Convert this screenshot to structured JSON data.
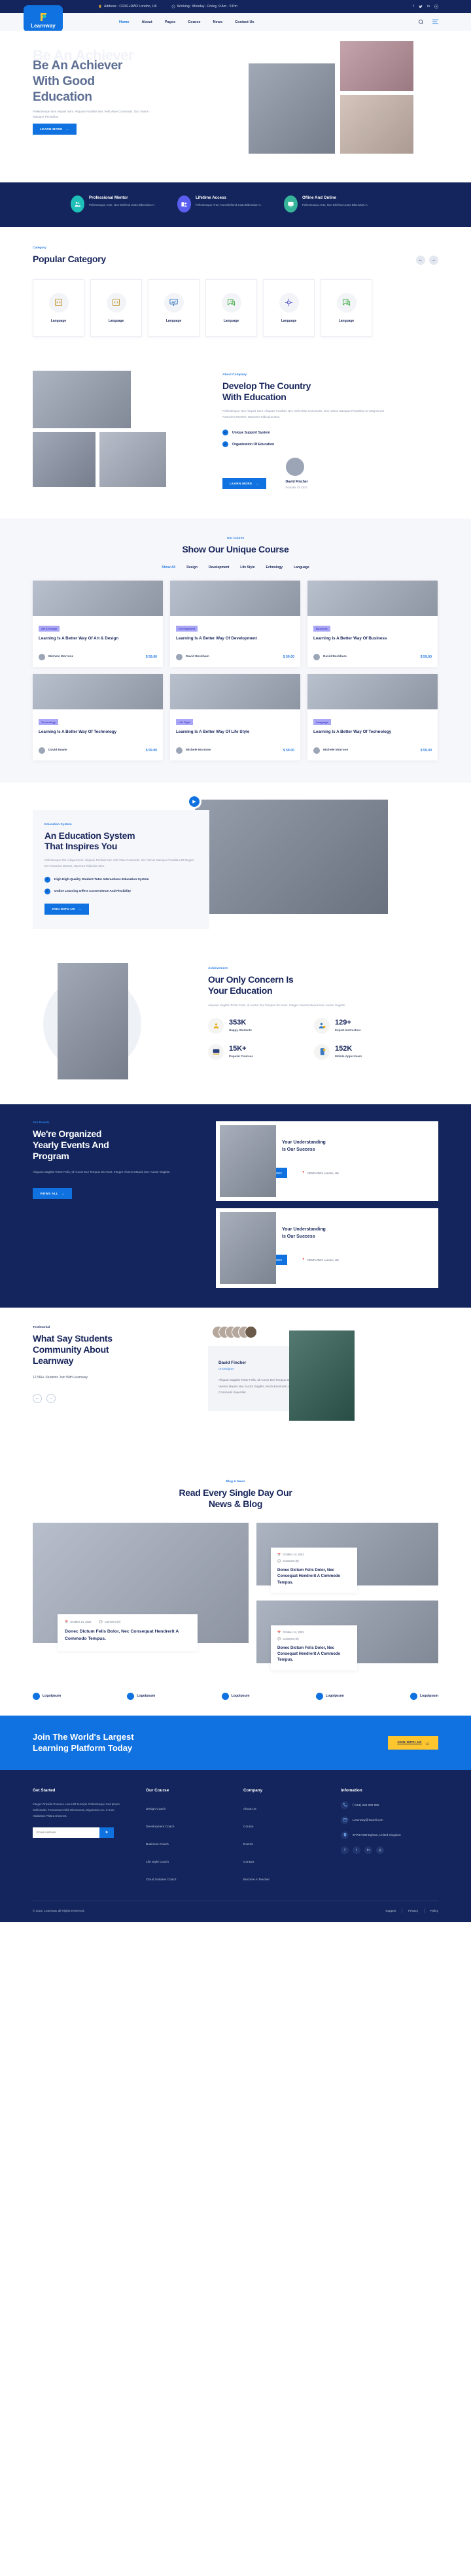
{
  "topbar": {
    "address": "Address : CRXF+RW3 London, UK",
    "working": "Working : Monday - Friday, 9:Am - 5:Pm",
    "social": [
      "facebook-icon",
      "twitter-icon",
      "linkedin-icon",
      "instagram-icon"
    ]
  },
  "nav": {
    "brand": "Learnway",
    "links": [
      {
        "label": "Home",
        "active": true
      },
      {
        "label": "About",
        "active": false
      },
      {
        "label": "Pages",
        "active": false,
        "caret": true
      },
      {
        "label": "Course",
        "active": false,
        "caret": true
      },
      {
        "label": "News",
        "active": false
      },
      {
        "label": "Contact Us",
        "active": false
      }
    ]
  },
  "hero": {
    "ghost": "Be An Achiever",
    "title_line1": "Be An Achiever",
    "title_line2": "With Good",
    "title_line3": "Education",
    "paragraph": "Pellentesque Non Aliquet Sem. Aliquam Facilisis Nec Velit Vitae Commodo. Orci Varius Natoque Penatibus",
    "cta": "LEARN MORE"
  },
  "features": [
    {
      "title": "Professional Mentor",
      "text": "Pellentesque Ante, Non Eleifend Justo Bibendum A.",
      "color": "#1fc0b8",
      "icon": "mentor-icon"
    },
    {
      "title": "Lifetime Access",
      "text": "Pellentesque Ante, Non Eleifend Justo Bibendum A.",
      "color": "#5a5ef0",
      "icon": "access-icon"
    },
    {
      "title": "Ofline And Online",
      "text": "Pellentesque Ante, Non Eleifend Justo Bibendum A.",
      "color": "#35b49a",
      "icon": "online-icon"
    }
  ],
  "category": {
    "eyebrow": "Category",
    "title": "Popular Category",
    "prev": "arrow-left-icon",
    "next": "arrow-right-icon",
    "items": [
      {
        "label": "Language",
        "icon": "code-icon"
      },
      {
        "label": "Language",
        "icon": "code-icon"
      },
      {
        "label": "Language",
        "icon": "chart-board-icon"
      },
      {
        "label": "Language",
        "icon": "chat-bubble-icon"
      },
      {
        "label": "Language",
        "icon": "network-icon"
      },
      {
        "label": "Language",
        "icon": "chat-bubble-icon"
      }
    ]
  },
  "about": {
    "eyebrow": "About Company",
    "title_line1": "Develop The Country",
    "title_line2": "With Education",
    "paragraph": "Pellentesque Non Aliquet Sem. Aliquam Facilisis Nec Velit Vitae Commodo. Orci Varius Natoque Penatibus Et Magnis Dis Parturient Montes, Nascetur Ridiculus Mus.",
    "checks": [
      "Unique Support System",
      "Organization Of Education"
    ],
    "cta": "LEARN MORE",
    "person_name": "David Fincher",
    "person_role": "Founder Of CEO"
  },
  "courses": {
    "eyebrow": "Our Course",
    "title": "Show Our Unique Course",
    "tabs": [
      {
        "label": "Show All",
        "active": true
      },
      {
        "label": "Design",
        "active": false
      },
      {
        "label": "Development",
        "active": false
      },
      {
        "label": "Life Style",
        "active": false
      },
      {
        "label": "Echnology",
        "active": false
      },
      {
        "label": "Language",
        "active": false
      }
    ],
    "items": [
      {
        "tag": "Art & Design",
        "title": "Learning Is A Better Way Of Art & Design",
        "author": "Michele Morrone",
        "price": "$ 59.00"
      },
      {
        "tag": "Development",
        "title": "Learning Is A Better Way Of Development",
        "author": "David Beckham",
        "price": "$ 59.00"
      },
      {
        "tag": "Business",
        "title": "Learning Is A Better Way Of Business",
        "author": "David Beckham",
        "price": "$ 59.00"
      },
      {
        "tag": "Technology",
        "title": "Learning Is A Better Way Of Technology",
        "author": "David Bowie",
        "price": "$ 59.00"
      },
      {
        "tag": "Life Style",
        "title": "Learning Is A Better Way Of Life Style",
        "author": "Michele Morrone",
        "price": "$ 59.00"
      },
      {
        "tag": "Language",
        "title": "Learning Is A Better Way Of Technology",
        "author": "Michele Morrone",
        "price": "$ 59.00"
      }
    ]
  },
  "edu": {
    "eyebrow": "Education System",
    "title_line1": "An Education System",
    "title_line2": "That Inspires You",
    "paragraph": "Pellentesque Non Aliquet Sem. Aliquam Facilisis Nec Velit Vitae Commodo. Orci Varius Natoque Penatibus Et Magnis Dis Parturient Montes, Nascetur Ridiculus Mus.",
    "checks": [
      "High High-Quality Student-Tutor Interactions Education System",
      "Online Learning Offers Convenience And Flexibility"
    ],
    "cta": "JOIN WITH US",
    "play": "play-icon"
  },
  "achievement": {
    "eyebrow": "Achievement",
    "title_line1": "Our Only Concern Is",
    "title_line2": "Your Education",
    "paragraph": "Aliquam Sagittis Tortor Felis, Id Auctor Dui Tempus Sit Amet. Integer Viverra Mauris Nec Auctor Sagittis.",
    "stats": [
      {
        "num": "353K",
        "label": "Happy Students",
        "icon": "students-icon"
      },
      {
        "num": "129+",
        "label": "Expert Instructors",
        "icon": "instructor-icon"
      },
      {
        "num": "15K+",
        "label": "Popular Courses",
        "icon": "courses-icon"
      },
      {
        "num": "152K",
        "label": "Mobile Apps Users",
        "icon": "mobile-icon"
      }
    ]
  },
  "events": {
    "eyebrow": "Our Events",
    "title_line1": "We're Organized",
    "title_line2": "Yearly Events And",
    "title_line3": "Program",
    "paragraph": "Aliquam Sagittis Tortor Felis, Id Auctor Dui Tempus Sit Amet. Integer Viverra Mauris Nec Auctor Sagittis.",
    "cta": "VIEWS ALL",
    "cards": [
      {
        "title_line1": "Your Understanding",
        "title_line2": "Is Our Success",
        "date": "31 March, 2022",
        "location": "CRXF+RW3 London, UK"
      },
      {
        "title_line1": "Your Understanding",
        "title_line2": "Is Our Success",
        "date": "31 March, 2022",
        "location": "CRXF+RW3 London, UK"
      }
    ]
  },
  "testimonial": {
    "eyebrow": "Testimonial",
    "title_line1": "What Say Students",
    "title_line2": "Community About",
    "title_line3": "Learnway",
    "note": "12.56k+ Students Join With Learnway",
    "prev": "arrow-left-icon",
    "next": "arrow-right-icon",
    "name": "David Fincher",
    "role": "UI-Designer",
    "quote": "Aliquam Sagittis Tortor Felis, Id Auctor Dui Tempus Sit Amet. Integer Viverra Mauris Nec Auctor Sagittis. Morbi Euismod Lacus Et Enim Commodo Imperdiet."
  },
  "blog": {
    "eyebrow": "Blog & News",
    "title_line1": "Read Every Single Day Our",
    "title_line2": "News & Blog",
    "main": {
      "date": "October 14, 2022",
      "comments": "Comment (0)",
      "title": "Donec Dictum Felis Dolor, Nec Consequat Hendrerit A Commodo Tempus."
    },
    "side": [
      {
        "date": "October 14, 2022",
        "comments": "Comment (0)",
        "title": "Donec Dictum Felis Dolor, Nec Consequat Hendrerit A Commodo Tempus."
      },
      {
        "date": "October 14, 2022",
        "comments": "Comment (0)",
        "title": "Donec Dictum Felis Dolor, Nec Consequat Hendrerit A Commodo Tempus."
      }
    ]
  },
  "brands": [
    {
      "label": "Logoipsum"
    },
    {
      "label": "Logoipsum"
    },
    {
      "label": "Logoipsum"
    },
    {
      "label": "Logoipsum"
    },
    {
      "label": "Logoipsum"
    }
  ],
  "cta": {
    "title_line1": "Join The World's Largest",
    "title_line2": "Learning Platform Today",
    "button": "JOIN WITH US"
  },
  "footer": {
    "get_started": {
      "title": "Get Started",
      "text": "Integer Gravida Posuere Lacus Et Suscipit. Pellentesque Sed Ipsum Sollicitudin, Fermentum Nibh Elementum, Dignissim Leo. In Hac Habitasse Platea Dictumst.",
      "email_placeholder": "Email Address",
      "send": "send-icon"
    },
    "our_course": {
      "title": "Our Course",
      "links": [
        "Design Coach",
        "Development Coach",
        "Business Coach",
        "Life Style Coach",
        "Cloud Solution Coach"
      ]
    },
    "company": {
      "title": "Company",
      "links": [
        "About Us",
        "Course",
        "Events",
        "Contact",
        "Become A Teacher"
      ]
    },
    "information": {
      "title": "Infomation",
      "phone": "(+001) 256 689 985",
      "email": "Learnway@Gamil.com",
      "address": "9FW6+599 Egham, United Kingdom",
      "social": [
        "facebook-icon",
        "twitter-icon",
        "linkedin-icon",
        "instagram-icon"
      ]
    },
    "copyright": "© 2022. Learnway all Rights Reserved.",
    "links": [
      "Support",
      "Privacy",
      "Policy"
    ]
  }
}
